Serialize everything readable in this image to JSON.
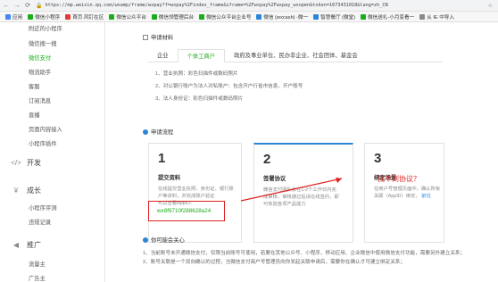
{
  "browser": {
    "url": "https://mp.weixin.qq.com/wxamp/frame/wxpay?f=wxpay%2Findex_frame&iframe=%2Fwxpay%2Fwxpay_wxopen&token=1673431018&lang=zh_CN",
    "bookmarks": [
      {
        "label": "应用",
        "color": "#4285f4"
      },
      {
        "label": "微信小程序",
        "color": "#1aad19"
      },
      {
        "label": "首页 风钉在区",
        "color": "#e53935"
      },
      {
        "label": "微信公众平台",
        "color": "#1aad19"
      },
      {
        "label": "微信领管理后台",
        "color": "#1aad19"
      },
      {
        "label": "微信公众平台企业号",
        "color": "#1aad19"
      },
      {
        "label": "微信 (wxcash) -微一",
        "color": "#2b86d8"
      },
      {
        "label": "智慧餐厅 (微堂)",
        "color": "#2b86d8"
      },
      {
        "label": "微信送礼-小月变看一",
        "color": "#1aad19"
      },
      {
        "label": "从 IE 中导入",
        "color": "#888888"
      }
    ]
  },
  "sidebar": {
    "items_top": [
      {
        "label": "附近的小程序"
      },
      {
        "label": "微信搜一搜"
      },
      {
        "label": "微信支付",
        "active": true
      },
      {
        "label": "物流助手"
      },
      {
        "label": "客服"
      },
      {
        "label": "订阅消息"
      },
      {
        "label": "直播"
      },
      {
        "label": "页面内容接入"
      },
      {
        "label": "小程序插件"
      }
    ],
    "group_dev": {
      "label": "开发",
      "icon": "code-icon"
    },
    "group_growth": {
      "label": "成长",
      "icon": "growth-icon"
    },
    "items_growth": [
      {
        "label": "小程序评测"
      },
      {
        "label": "违规记录"
      }
    ],
    "group_promo": {
      "label": "推广",
      "icon": "megaphone-icon"
    },
    "items_promo": [
      {
        "label": "流量主"
      },
      {
        "label": "广告主"
      }
    ]
  },
  "main": {
    "materials_title": "申请材料",
    "tabs": [
      {
        "label": "企业"
      },
      {
        "label": "个体工商户",
        "active": true
      },
      {
        "label": "政府及事业单位、民办非企业、社会团体、基金会"
      }
    ],
    "requirements": [
      "1、营业执照：彩色扫描件或数码照片",
      "2、对公银行账户为法人对私账户：包含开户行省市信息，开户账号",
      "3、法人身份证：彩色扫描件或数码照片"
    ],
    "flow_title": "申请流程",
    "steps": [
      {
        "num": "1",
        "title": "提交资料",
        "desc": "在线提交营业执照、身份证、银行账户等资料，并完成账户验证",
        "extra": "可以查看AppID：",
        "code": "wx8f9710f288628a24"
      },
      {
        "num": "2",
        "title": "签署协议",
        "desc": "微信支付团队会在1-2个工作日内完成审核，审核通过后请在线签约，即可体验各项产品能力"
      },
      {
        "num": "3",
        "title": "绑定场景",
        "desc": "在商户号管理页面中，确认所有关联（AppID）绑定，",
        "link": "前往"
      }
    ],
    "annotation": "找不到协议？",
    "notes_title": "你可能会关心",
    "notes": [
      "1、当前账号未开通微信支付，仅限当前账号可使用，若要在其他公众号、小程序、移动应用、企业微信中使用微信支付功能，需要另外建立关系；",
      "2、账号关联是一个双向确认的过程，当微信支付商户号管理员向你发起关联申请后，需要你在确认才可建立绑定关系；"
    ]
  }
}
